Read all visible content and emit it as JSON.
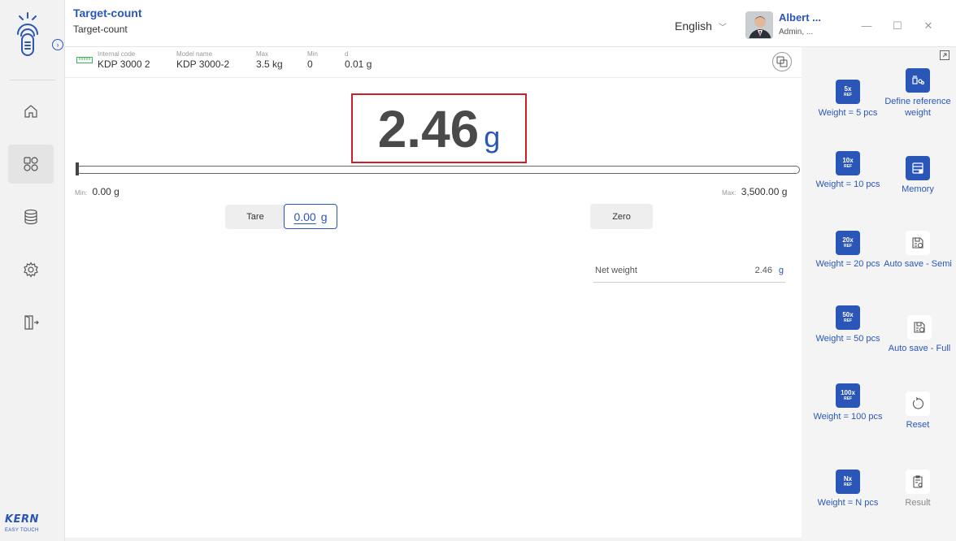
{
  "header": {
    "title": "Target-count",
    "subtitle": "Target-count",
    "language": "English",
    "user_name": "Albert ...",
    "user_role": "Admin, ...",
    "win_minimize": "—",
    "win_maximize": "☐",
    "win_close": "✕"
  },
  "sidebar": {
    "expand_glyph": "›",
    "brand": "KERN",
    "brand_sub": "EASY TOUCH",
    "items": [
      {
        "name": "home-icon",
        "active": false
      },
      {
        "name": "applications-icon",
        "active": true
      },
      {
        "name": "database-icon",
        "active": false
      },
      {
        "name": "settings-icon",
        "active": false
      },
      {
        "name": "logout-icon",
        "active": false
      }
    ]
  },
  "info": {
    "internal_code_label": "Internal code",
    "internal_code": "KDP 3000 2",
    "model_name_label": "Model name",
    "model_name": "KDP 3000-2",
    "max_label": "Max",
    "max": "3.5 kg",
    "min_label": "Min",
    "min": "0",
    "d_label": "d",
    "d": "0.01 g"
  },
  "display": {
    "weight": "2.46",
    "unit": "g",
    "range_min_prefix": "Min:",
    "range_min": "0.00 g",
    "range_max_prefix": "Max:",
    "range_max": "3,500.00 g",
    "range_fill_fraction": 0.0007
  },
  "controls": {
    "tare_label": "Tare",
    "tare_value": "0.00",
    "tare_unit": "g",
    "zero_label": "Zero"
  },
  "net": {
    "label": "Net weight",
    "value": "2.46",
    "unit": "g"
  },
  "functions": {
    "ref5_top": "5x",
    "ref5_bottom": "REF",
    "ref5_label": "Weight = 5 pcs",
    "define_label": "Define reference weight",
    "ref10_top": "10x",
    "ref10_bottom": "REF",
    "ref10_label": "Weight = 10 pcs",
    "memory_label": "Memory",
    "ref20_top": "20x",
    "ref20_bottom": "REF",
    "ref20_label": "Weight = 20 pcs",
    "autosave_semi_label": "Auto save - Semi",
    "ref50_top": "50x",
    "ref50_bottom": "REF",
    "ref50_label": "Weight = 50 pcs",
    "autosave_full_label": "Auto save - Full",
    "ref100_top": "100x",
    "ref100_bottom": "REF",
    "ref100_label": "Weight = 100 pcs",
    "reset_label": "Reset",
    "refn_top": "Nx",
    "refn_bottom": "REF",
    "refn_label": "Weight = N pcs",
    "result_label": "Result"
  },
  "colors": {
    "accent": "#2a56b8",
    "highlight_border": "#cc2028"
  }
}
